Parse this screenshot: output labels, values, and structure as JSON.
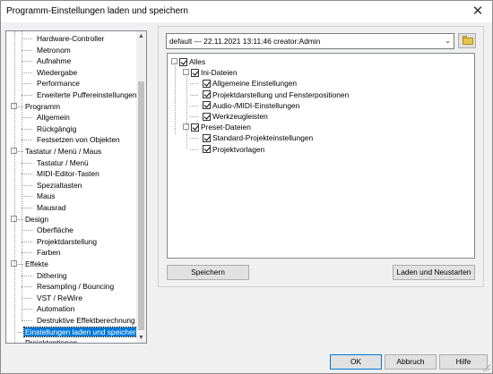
{
  "window": {
    "title": "Programm-Einstellungen laden und speichern",
    "close_glyph": "✕"
  },
  "tree": {
    "items": [
      {
        "label": "Hardware-Controller",
        "level": 1
      },
      {
        "label": "Metronom",
        "level": 1
      },
      {
        "label": "Aufnahme",
        "level": 1
      },
      {
        "label": "Wiedergabe",
        "level": 1
      },
      {
        "label": "Performance",
        "level": 1
      },
      {
        "label": "Erweiterte Puffereinstellungen",
        "level": 1
      },
      {
        "label": "Programm",
        "level": 0
      },
      {
        "label": "Allgemein",
        "level": 1
      },
      {
        "label": "Rückgängig",
        "level": 1
      },
      {
        "label": "Festsetzen von Objekten",
        "level": 1
      },
      {
        "label": "Tastatur / Menü / Maus",
        "level": 0
      },
      {
        "label": "Tastatur / Menü",
        "level": 1
      },
      {
        "label": "MIDI-Editor-Tasten",
        "level": 1
      },
      {
        "label": "Spezialtasten",
        "level": 1
      },
      {
        "label": "Maus",
        "level": 1
      },
      {
        "label": "Mausrad",
        "level": 1
      },
      {
        "label": "Design",
        "level": 0
      },
      {
        "label": "Oberfläche",
        "level": 1
      },
      {
        "label": "Projektdarstellung",
        "level": 1
      },
      {
        "label": "Farben",
        "level": 1
      },
      {
        "label": "Effekte",
        "level": 0
      },
      {
        "label": "Dithering",
        "level": 1
      },
      {
        "label": "Resampling / Bouncing",
        "level": 1
      },
      {
        "label": "VST / ReWire",
        "level": 1
      },
      {
        "label": "Automation",
        "level": 1
      },
      {
        "label": "Destruktive Effektberechnung",
        "level": 1
      },
      {
        "label": "Einstellungen laden und speichern",
        "level": 0,
        "selected": true
      },
      {
        "label": "Projektoptionen",
        "level": 0
      }
    ],
    "expander_glyph": "−",
    "scroll_up": "▲",
    "scroll_down": "▼"
  },
  "preset": {
    "value": "default --- 22.11.2021  13:11:46 creator:Admin",
    "dropdown_glyph": "⌄"
  },
  "options": {
    "all": "Alles",
    "ini_group": "Ini-Dateien",
    "ini_items": [
      "Allgemeine Einstellungen",
      "Projektdarstellung und Fensterpositionen",
      "Audio-/MIDI-Einstellungen",
      "Werkzeugleisten"
    ],
    "preset_group": "Preset-Dateien",
    "preset_items": [
      "Standard-Projekteinstellungen",
      "Projektvorlagen"
    ]
  },
  "buttons": {
    "save": "Speichern",
    "load_restart": "Laden und Neustarten",
    "ok": "OK",
    "cancel": "Abbruch",
    "help": "Hilfe"
  },
  "colors": {
    "selection": "#0078d7",
    "window_bg": "#f0f0f0"
  }
}
